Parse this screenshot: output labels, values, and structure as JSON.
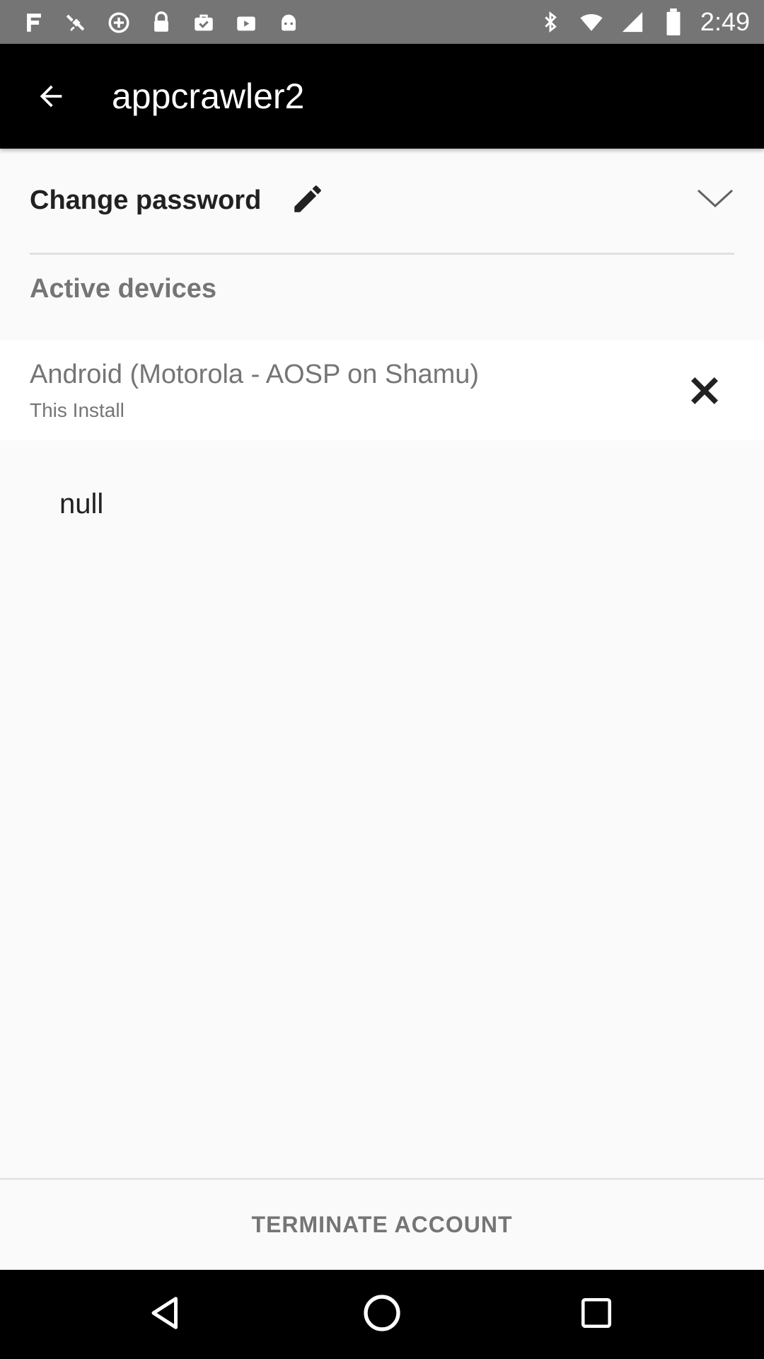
{
  "status_bar": {
    "time": "2:49",
    "left_icons": [
      "fake-gps-icon",
      "satellite-icon",
      "data-saver-icon",
      "lock-icon",
      "briefcase-check-icon",
      "play-store-icon",
      "android-icon"
    ],
    "right_icons": [
      "bluetooth-icon",
      "wifi-icon",
      "cell-signal-icon",
      "battery-icon"
    ]
  },
  "app_bar": {
    "title": "appcrawler2",
    "back_icon": "arrow-back-icon",
    "background": "#000000"
  },
  "change_password": {
    "label": "Change password",
    "edit_icon": "pencil-icon",
    "expand_icon": "chevron-down-icon"
  },
  "active_devices": {
    "title": "Active devices",
    "devices": [
      {
        "name": "Android (Motorola - AOSP on Shamu)",
        "subtitle": "This Install",
        "remove_icon": "close-icon"
      }
    ]
  },
  "null_text": "null",
  "terminate": {
    "label": "TERMINATE ACCOUNT"
  },
  "nav_bar": {
    "buttons": [
      "back-triangle-icon",
      "home-circle-icon",
      "recents-square-icon"
    ]
  }
}
